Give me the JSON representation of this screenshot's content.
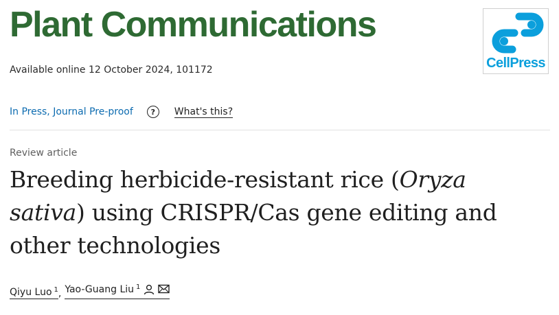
{
  "journal": {
    "title": "Plant Communications",
    "title_color": "#2e6a33"
  },
  "publisher": {
    "logo_text": "CellPress",
    "logo_color": "#0b9fdc",
    "logo_icon": "cellpress-logo-icon"
  },
  "availability": "Available online 12 October 2024, 101172",
  "status": {
    "label": "In Press, Journal Pre-proof",
    "help_icon": "question-circle-icon",
    "help_symbol": "?",
    "whats_this": "What's this?"
  },
  "article": {
    "type": "Review article",
    "title_part1": "Breeding herbicide-resistant rice (",
    "title_italic": "Oryza sativa",
    "title_part2": ") using CRISPR/Cas gene editing and other technologies"
  },
  "authors": [
    {
      "name": "Qiyu Luo",
      "affiliation": "1"
    },
    {
      "name": "Yao-Guang Liu",
      "affiliation": "1",
      "icons": [
        "person-icon",
        "envelope-icon"
      ]
    }
  ],
  "author_separator": ","
}
